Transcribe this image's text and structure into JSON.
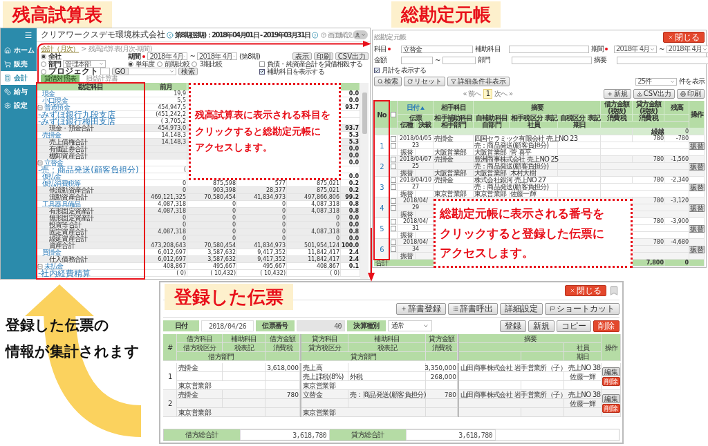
{
  "annotations": {
    "trial_balance_title": "残高試算表",
    "ledger_title": "総勘定元帳",
    "voucher_title": "登録した伝票",
    "trial_balance_callout": [
      "残高試算表に表示される科目を",
      "クリックすると総勘定元帳に",
      "アクセスします。"
    ],
    "ledger_callout": [
      "総勘定元帳に表示される番号を",
      "クリックすると登録した伝票に",
      "アクセスします。"
    ],
    "summary_note": [
      "登録した伝票の",
      "情報が集計されます"
    ]
  },
  "trial_balance": {
    "sidebar": [
      {
        "kind": "home",
        "label": "ホーム",
        "selected": false
      },
      {
        "kind": "sales",
        "label": "販売",
        "selected": false
      },
      {
        "kind": "accounting",
        "label": "会計",
        "selected": true
      },
      {
        "kind": "payroll",
        "label": "給与",
        "selected": false
      },
      {
        "kind": "settings",
        "label": "設定",
        "selected": false
      }
    ],
    "company": "クリアワークスデモ環境株式会社",
    "period": "第8期(翌期)：2018年04月01日 - 2019年03月31日",
    "help": "画面解説",
    "breadcrumb": {
      "link": "会計（月次）",
      "separator": ">",
      "current": "残高試算表(月次-期間)"
    },
    "scope": [
      {
        "label": "全社",
        "selected": true
      },
      {
        "label": "部門",
        "selected": false
      },
      {
        "label": "プロジェクト",
        "selected": false
      }
    ],
    "department": "管理本部",
    "go": "GO",
    "search": "検索",
    "period_label": "期間",
    "period_required": true,
    "period_from": "2018年 4月",
    "tilde": "~",
    "period_to": "2018年 4月",
    "term": "(第8期)",
    "buttons": [
      "表示",
      "印刷",
      "CSV出力"
    ],
    "compare": [
      {
        "label": "単年度",
        "selected": true
      },
      {
        "label": "前期比較",
        "selected": false
      },
      {
        "label": "3期比較",
        "selected": false
      }
    ],
    "options": [
      {
        "label": "負債・純資産合計を貸借相殺する",
        "checked": false
      },
      {
        "label": "補助科目を表示する",
        "checked": true
      }
    ],
    "tabs": [
      {
        "label": "貸借対照表",
        "selected": true
      },
      {
        "label": "損益計算書",
        "selected": false
      }
    ],
    "columns": [
      "勘定科目",
      "前月"
    ],
    "rows": [
      {
        "kind": "account",
        "account": "現金",
        "prior": "19,9",
        "ratio": "0.0"
      },
      {
        "kind": "account",
        "account": "小口現金",
        "prior": "5,5",
        "ratio": "0.0"
      },
      {
        "kind": "group",
        "account": "普通預金",
        "prior": "454,947,5",
        "ratio": "93.7"
      },
      {
        "kind": "sub",
        "account": "-みずほ銀行九段支店",
        "prior": "(451,242,2"
      },
      {
        "kind": "sub",
        "account": "-みずほ銀行梅田支店",
        "prior": "( 3,705,2"
      },
      {
        "kind": "total",
        "account": "現金・預金合計",
        "prior": "454,973,0",
        "ratio": "93.7"
      },
      {
        "kind": "account",
        "account": "売掛金",
        "prior": "14,148,3",
        "ratio": "5.3"
      },
      {
        "kind": "total",
        "account": "売上債権合計",
        "prior": "14,148,3",
        "ratio": "5.3"
      },
      {
        "kind": "total",
        "account": "有価証券合計",
        "ratio": "0.0"
      },
      {
        "kind": "total",
        "account": "棚卸資産合計",
        "ratio": "0.0"
      },
      {
        "kind": "group",
        "account": "立替金",
        "ratio": "0.0"
      },
      {
        "kind": "sub",
        "account": "-売：商品発送(顧客負担分)",
        "prior": "("
      },
      {
        "kind": "account",
        "account": "仮払金",
        "ratio": "0.0"
      },
      {
        "kind": "account",
        "account": "仮払消費税等",
        "prior": "0",
        "debit": "875,598",
        "credit": "577",
        "balance": "875,021",
        "ratio": "0.2"
      },
      {
        "kind": "total",
        "account": "他流動資産合計",
        "prior": "0",
        "debit": "903,398",
        "credit": "28,377",
        "balance": "875,021",
        "ratio": "0.2"
      },
      {
        "kind": "total",
        "account": "流動資産合計",
        "prior": "469,121,325",
        "debit": "70,580,454",
        "credit": "41,834,973",
        "balance": "497,866,806",
        "ratio": "99.2"
      },
      {
        "kind": "account",
        "account": "工具器具備品",
        "prior": "4,087,318",
        "debit": "0",
        "credit": "0",
        "balance": "4,087,318",
        "ratio": "0.8"
      },
      {
        "kind": "total",
        "account": "有形固定資産計",
        "prior": "4,087,318",
        "debit": "0",
        "credit": "0",
        "balance": "4,087,318",
        "ratio": "0.8"
      },
      {
        "kind": "total",
        "account": "無形固定資産計",
        "prior": "0",
        "debit": "0",
        "credit": "0",
        "balance": "0",
        "ratio": "0.0"
      },
      {
        "kind": "total",
        "account": "投資等合計",
        "prior": "0",
        "debit": "0",
        "credit": "0",
        "balance": "0",
        "ratio": "0.0"
      },
      {
        "kind": "total",
        "account": "固定資産合計",
        "prior": "4,087,318",
        "debit": "0",
        "credit": "0",
        "balance": "4,087,318",
        "ratio": "0.8"
      },
      {
        "kind": "total",
        "account": "繰延資産合計",
        "prior": "0",
        "debit": "0",
        "credit": "0",
        "balance": "0",
        "ratio": "0.0"
      },
      {
        "kind": "total",
        "account": "資産合計",
        "prior": "473,208,643",
        "debit": "70,580,454",
        "credit": "41,834,973",
        "balance": "501,954,124",
        "ratio": "100.0"
      },
      {
        "kind": "account",
        "account": "買掛金",
        "prior": "6,012,697",
        "debit": "3,587,632",
        "credit": "9,417,352",
        "balance": "11,842,417",
        "ratio": "2.4"
      },
      {
        "kind": "total",
        "account": "仕入債務合計",
        "prior": "6,012,697",
        "debit": "3,587,632",
        "credit": "9,417,352",
        "balance": "11,842,417",
        "ratio": "2.4"
      },
      {
        "kind": "group",
        "account": "未払金",
        "prior": "408,867",
        "debit": "495,667",
        "credit": "495,667",
        "balance": "408,867",
        "ratio": "0.1"
      },
      {
        "kind": "sub",
        "account": "-社内経費精算",
        "prior": "( 0)",
        "debit": "( 10,432)",
        "credit": "( 10,432)",
        "balance": "( 0)"
      }
    ]
  },
  "ledger": {
    "title": "総勘定元帳",
    "close": "閉じる",
    "filters": {
      "account_label": "科目",
      "account_required": true,
      "account_value": "立替金",
      "sub_label": "補助科目",
      "period_label": "期間",
      "period_required": true,
      "period_from": "2018年 4月",
      "tilde": "~",
      "period_to": "2018年 4月",
      "amount_label": "金額",
      "amount_tilde": "~",
      "dept_label": "部門",
      "memo_label": "摘要"
    },
    "monthly_total": {
      "label": "月計を表示する",
      "checked": true
    },
    "search_buttons": [
      {
        "kind": "search",
        "label": "検索"
      },
      {
        "kind": "reset",
        "label": "リセット"
      },
      {
        "kind": "filter",
        "label": "詳細条件非表示"
      }
    ],
    "page_size": "25件",
    "page_size_label": "件を表示",
    "pagination": {
      "prev": "« 前へ",
      "pages": [
        {
          "label": "1",
          "selected": true
        }
      ],
      "next": "次へ »"
    },
    "actions": [
      {
        "kind": "new",
        "label": "新規"
      },
      {
        "kind": "csv",
        "label": "CSV出力"
      },
      {
        "kind": "print",
        "label": "印刷"
      }
    ],
    "header": {
      "no": "No",
      "date": "日付",
      "counter": "相手科目",
      "memo": "摘要",
      "debit": "借方金額(税抜)",
      "credit": "貸方金額(税抜)",
      "balance": "残高",
      "action": "操作",
      "slip": "伝票",
      "counter_sub": "相手補助科目",
      "own_sub": "自補助科目",
      "counter_tax": "相手税区分",
      "notation_1": "表記",
      "own_tax": "自税区分",
      "notation_2": "表記",
      "debit_tax": "消費税",
      "credit_tax": "消費税",
      "type": "伝種",
      "approval": "決裁",
      "counter_dept": "相手部門",
      "own_dept": "自部門",
      "staff": "社員",
      "due": "期日"
    },
    "select_all": {
      "checked": false
    },
    "carry": {
      "label": "繰越",
      "balance": "0"
    },
    "entries": [
      {
        "no": "1",
        "row_checks": [
          {
            "checked": false
          },
          {
            "checked": false
          }
        ],
        "date": "2018/04/05",
        "counter": "売掛金",
        "memo": "四国セラミック有限会社 売上NO 23",
        "credit": "780",
        "balance": "-780",
        "slip": "23",
        "own_sub": "売：商品発送(顧客負担分)",
        "type": "振替",
        "counter_dept": "大阪営業部",
        "own_dept": "大阪営業部",
        "staff": "菅 喜平",
        "action": "振替"
      },
      {
        "no": "2",
        "row_checks": [
          {
            "checked": false
          },
          {
            "checked": false
          }
        ],
        "date": "2018/04/07",
        "counter": "売掛金",
        "memo": "豊洲商事株式会社 売上NO 25",
        "credit": "780",
        "balance": "-1,560",
        "slip": "25",
        "own_sub": "売：商品発送(顧客負担分)",
        "type": "振替",
        "counter_dept": "大阪営業部",
        "own_dept": "大阪営業部",
        "staff": "木村大樹",
        "action": "振替"
      },
      {
        "no": "3",
        "row_checks": [
          {
            "checked": false
          },
          {
            "checked": false
          }
        ],
        "date": "2018/04/10",
        "counter": "売掛金",
        "memo": "株式会社銀河 売上NO 27",
        "credit": "780",
        "balance": "-2,340",
        "slip": "27",
        "own_sub": "売：商品発送(顧客負担分)",
        "type": "振替",
        "counter_dept": "東京営業部",
        "own_dept": "東京営業部",
        "staff": "佐藤一輝",
        "action": "振替"
      },
      {
        "no": "4",
        "row_checks": [
          {
            "checked": false
          },
          {
            "checked": false
          }
        ],
        "date": "2018/04/",
        "credit": "780",
        "balance": "-3,120",
        "slip": "29",
        "type": "振替",
        "action": "振替"
      },
      {
        "no": "5",
        "row_checks": [
          {
            "checked": false
          },
          {
            "checked": false
          }
        ],
        "date": "2018/04/",
        "credit": "780",
        "balance": "-3,900",
        "slip": "31",
        "type": "振替",
        "action": "振替"
      },
      {
        "no": "6",
        "row_checks": [
          {
            "checked": false
          },
          {
            "checked": false
          }
        ],
        "date": "2018/04/",
        "credit": "780",
        "balance": "-4,680",
        "slip": "34",
        "type": "振替",
        "action": "振替"
      }
    ],
    "total": {
      "label": "合計",
      "credit": "7,800",
      "balance": "0"
    }
  },
  "voucher": {
    "close": "閉じる",
    "tools": [
      {
        "kind": "add",
        "label": "辞書登録"
      },
      {
        "kind": "list",
        "label": "辞書呼出"
      },
      {
        "kind": "plain",
        "label": "詳細設定"
      },
      {
        "kind": "flag",
        "label": "ショートカット"
      }
    ],
    "date_label": "日付",
    "date": "2018/04/26",
    "number_label": "伝票番号",
    "number": "40",
    "closing_label": "決算種別",
    "closing": "通常",
    "actions": [
      {
        "kind": "normal",
        "label": "登録"
      },
      {
        "kind": "normal",
        "label": "新規"
      },
      {
        "kind": "normal",
        "label": "コピー"
      },
      {
        "kind": "danger",
        "label": "削除"
      }
    ],
    "header": {
      "index": "#",
      "debit_account": "借方科目",
      "debit_sub": "補助科目",
      "debit_amount": "借方金額",
      "credit_account": "貸方科目",
      "credit_sub": "補助科目",
      "credit_amount": "貸方金額",
      "memo": "摘要",
      "action": "操作",
      "debit_tax_class": "借方税区分",
      "debit_tax_note": "税表記",
      "debit_tax": "消費税",
      "credit_tax_class": "貸方税区分",
      "credit_tax_note": "税表記",
      "credit_tax": "消費税",
      "staff": "社員",
      "debit_dept": "借方部門",
      "credit_dept": "貸方部門",
      "due": "期日"
    },
    "lines": [
      {
        "index": "1",
        "debit_account": "売掛金",
        "debit_amount": "3,618,000",
        "credit_account": "売上高",
        "credit_amount": "3,350,000",
        "memo": "山田商事株式会社 岩手営業所（子） 売上NO 38",
        "credit_tax_class": "売上課税(8%)",
        "credit_tax_note": "外税",
        "credit_tax": "268,000",
        "staff": "佐藤一輝",
        "debit_dept": "東京営業部",
        "credit_dept": "東京営業部",
        "edit": "編集",
        "delete": "削除"
      },
      {
        "index": "2",
        "debit_account": "売掛金",
        "debit_amount": "780",
        "credit_account": "立替金",
        "credit_sub": "売：商品発送(顧客負担分)",
        "credit_amount": "780",
        "memo": "山田商事株式会社 岩手営業所（子） 売上NO 38",
        "staff": "佐藤一輝",
        "debit_dept": "東京営業部",
        "credit_dept": "東京営業部",
        "edit": "編集",
        "delete": "削除"
      }
    ],
    "totals": [
      {
        "label": "借方総合計",
        "value": "3,618,780"
      },
      {
        "label": "貸方総合計",
        "value": "3,618,780"
      }
    ]
  }
}
